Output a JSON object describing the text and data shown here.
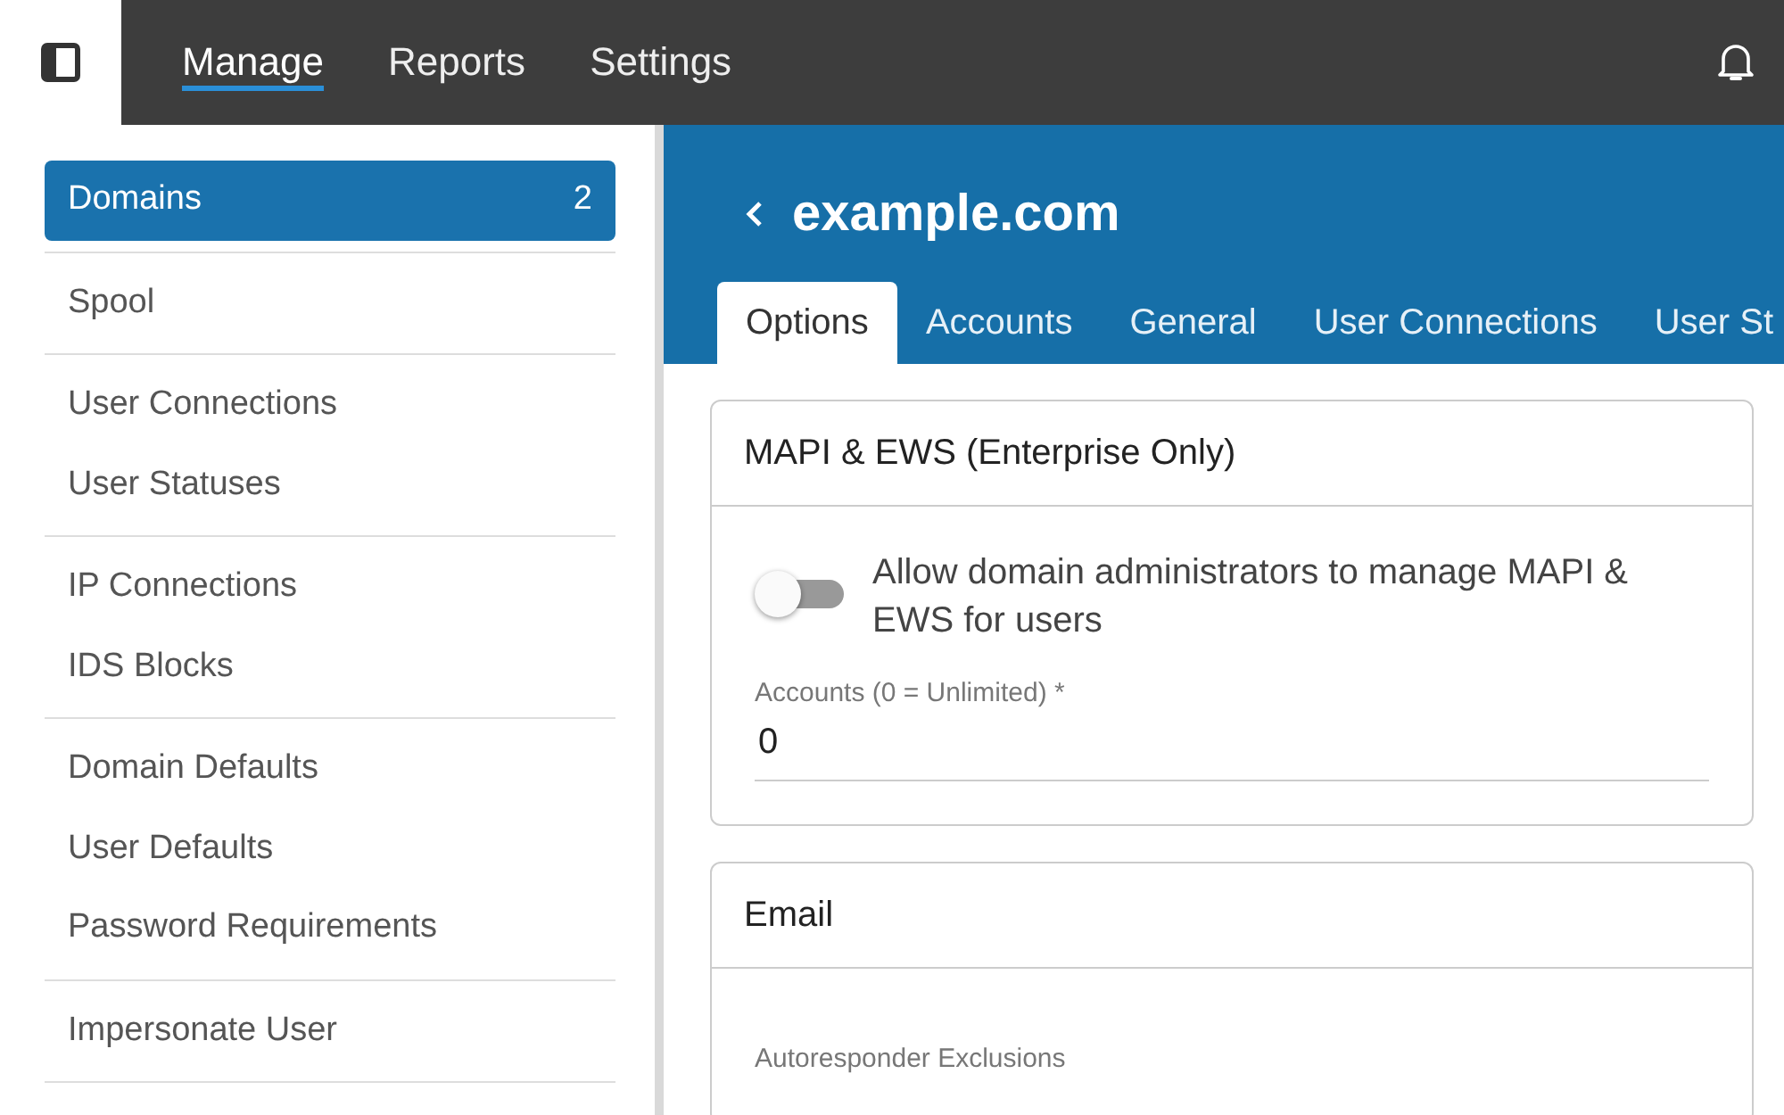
{
  "topbar": {
    "nav": [
      {
        "label": "Manage",
        "selected": true
      },
      {
        "label": "Reports",
        "selected": false
      },
      {
        "label": "Settings",
        "selected": false
      }
    ]
  },
  "sidebar": {
    "groups": [
      [
        {
          "label": "Domains",
          "selected": true,
          "badge": "2"
        }
      ],
      [
        {
          "label": "Spool",
          "selected": false
        }
      ],
      [
        {
          "label": "User Connections",
          "selected": false
        },
        {
          "label": "User Statuses",
          "selected": false
        }
      ],
      [
        {
          "label": "IP Connections",
          "selected": false
        },
        {
          "label": "IDS Blocks",
          "selected": false
        }
      ],
      [
        {
          "label": "Domain Defaults",
          "selected": false
        },
        {
          "label": "User Defaults",
          "selected": false
        },
        {
          "label": "Password Requirements",
          "selected": false
        }
      ],
      [
        {
          "label": "Impersonate User",
          "selected": false
        }
      ]
    ]
  },
  "header": {
    "title": "example.com",
    "tabs": [
      {
        "label": "Options",
        "selected": true
      },
      {
        "label": "Accounts",
        "selected": false
      },
      {
        "label": "General",
        "selected": false
      },
      {
        "label": "User Connections",
        "selected": false
      },
      {
        "label": "User St",
        "selected": false
      }
    ]
  },
  "cards": [
    {
      "title": "MAPI & EWS (Enterprise Only)",
      "fields": [
        {
          "kind": "toggle",
          "label": "Allow domain administrators to manage MAPI & EWS for users",
          "on": false
        },
        {
          "kind": "input",
          "label": "Accounts (0 = Unlimited) *",
          "value": "0"
        }
      ]
    },
    {
      "title": "Email",
      "fields": [
        {
          "kind": "input",
          "label": "Autoresponder Exclusions"
        }
      ]
    }
  ]
}
